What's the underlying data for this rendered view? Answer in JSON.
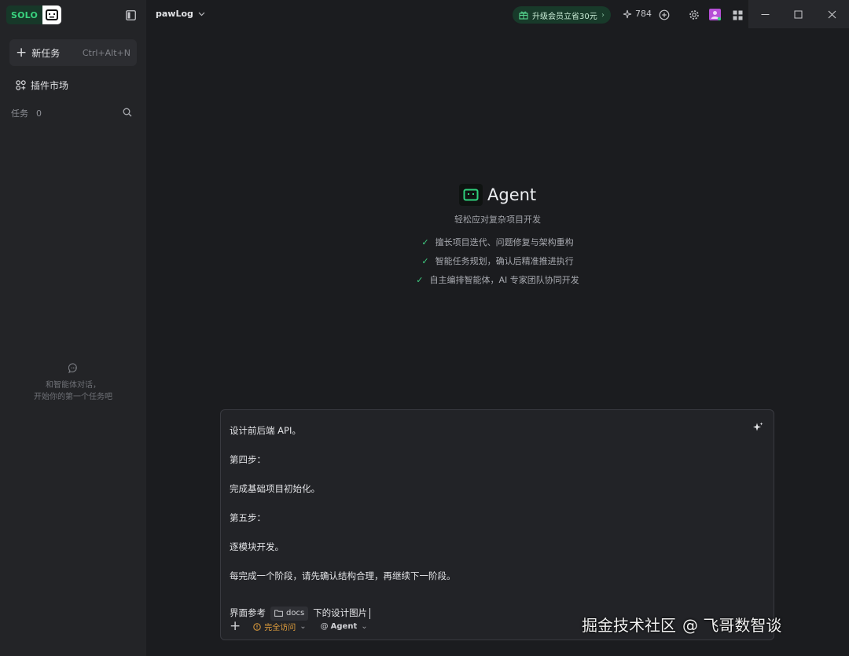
{
  "sidebar": {
    "brand": "SOLO",
    "new_task_label": "新任务",
    "new_task_shortcut": "Ctrl+Alt+N",
    "plugin_market_label": "插件市场",
    "tasks_label": "任务",
    "tasks_count": "0",
    "empty_line1": "和智能体对话，",
    "empty_line2": "开始你的第一个任务吧"
  },
  "topbar": {
    "project_name": "pawLog",
    "upgrade_label": "升级会员立省30元",
    "credits": "784"
  },
  "hero": {
    "title": "Agent",
    "subtitle": "轻松应对复杂项目开发",
    "features": [
      "擅长项目迭代、问题修复与架构重构",
      "智能任务规划，确认后精准推进执行",
      "自主编排智能体，AI 专家团队协同开发"
    ]
  },
  "composer": {
    "lines": [
      "设计前后端 API。",
      "第四步：",
      "完成基础项目初始化。",
      "第五步：",
      "逐模块开发。",
      "每完成一个阶段，请先确认结构合理，再继续下一阶段。"
    ],
    "last_prefix": "界面参考",
    "folder_chip": "docs",
    "last_suffix": "下的设计图片",
    "access_label": "完全访问",
    "agent_label": "Agent"
  },
  "watermark": {
    "text_a": "掘金技术社区",
    "text_b": "@ 飞哥数智谈"
  },
  "colors": {
    "accent_green": "#39d27e",
    "warning_orange": "#e3a03d",
    "background": "#1b1c1f",
    "sidebar": "#232427"
  }
}
